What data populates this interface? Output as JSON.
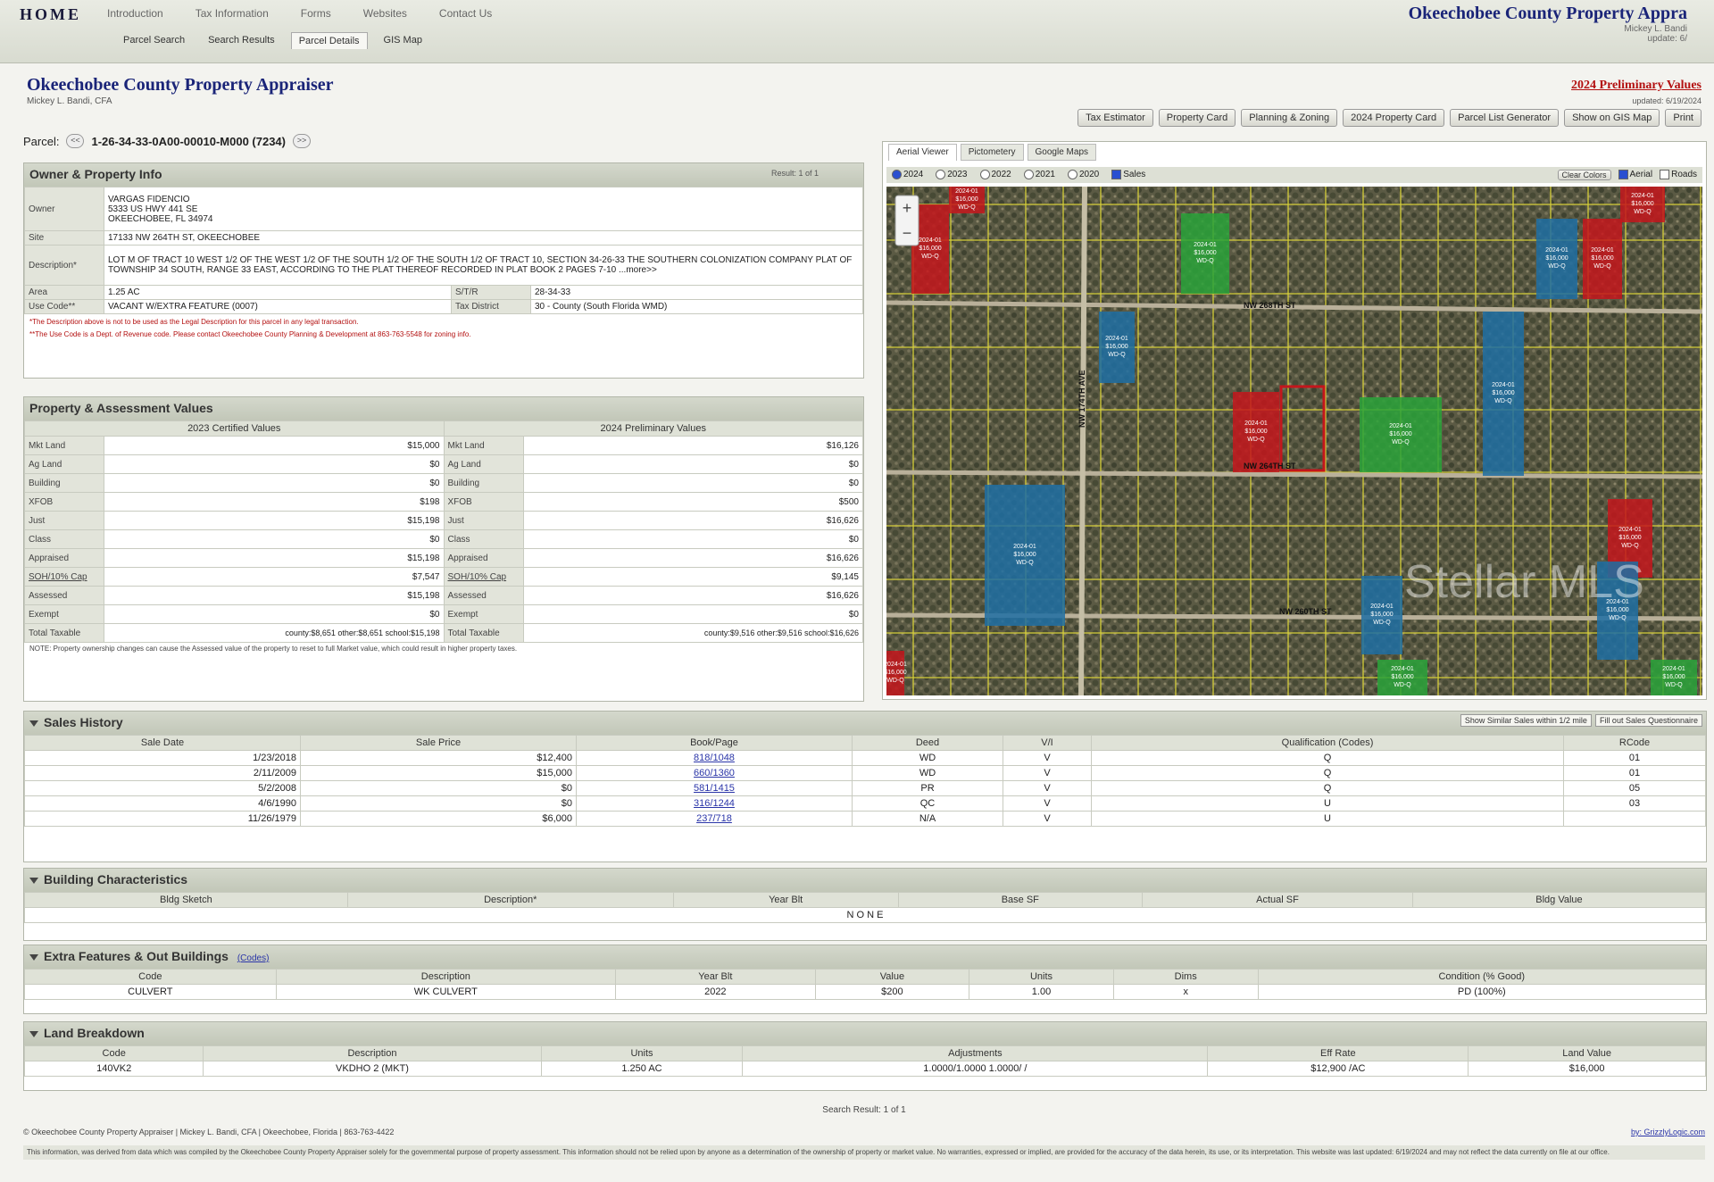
{
  "topnav": {
    "home": "HOME",
    "menu": [
      "Introduction",
      "Tax Information",
      "Forms",
      "Websites",
      "Contact Us"
    ],
    "subtabs": [
      "Parcel Search",
      "Search Results",
      "Parcel Details",
      "GIS Map"
    ],
    "brand_title": "Okeechobee County Property Appra",
    "brand_sub": "Mickey L. Bandi",
    "brand_sub2": "update: 6/"
  },
  "header": {
    "title": "Okeechobee County Property Appraiser",
    "subtitle": "Mickey L. Bandi, CFA",
    "prelim_link": "2024 Preliminary Values",
    "prelim_sub": "updated: 6/19/2024",
    "actions": [
      "Tax Estimator",
      "Property Card",
      "Planning & Zoning",
      "2024 Property Card",
      "Parcel List Generator",
      "Show on GIS Map",
      "Print"
    ],
    "parcel_label": "Parcel:",
    "parcel_id": "1-26-34-33-0A00-00010-M000 (7234)"
  },
  "owner": {
    "title": "Owner & Property Info",
    "result": "Result: 1 of 1",
    "rows": [
      {
        "label": "Owner",
        "value": "VARGAS FIDENCIO\n5333 US HWY 441 SE\nOKEECHOBEE, FL 34974"
      },
      {
        "label": "Site",
        "value": "17133 NW 264TH ST, OKEECHOBEE"
      },
      {
        "label": "Description*",
        "value": "LOT M OF TRACT 10 WEST 1/2 OF THE WEST 1/2 OF THE SOUTH 1/2 OF THE SOUTH 1/2 OF TRACT 10, SECTION 34-26-33 THE SOUTHERN COLONIZATION COMPANY PLAT OF TOWNSHIP 34 SOUTH, RANGE 33 EAST, ACCORDING TO THE PLAT THEREOF RECORDED IN PLAT BOOK 2 PAGES 7-10 ...more>>"
      }
    ],
    "area_label": "Area",
    "area": "1.25 AC",
    "str_label": "S/T/R",
    "str": "28-34-33",
    "usecode_label": "Use Code**",
    "usecode": "VACANT W/EXTRA FEATURE (0007)",
    "taxdist_label": "Tax District",
    "taxdist": "30 - County (South Florida WMD)",
    "note1": "*The Description above is not to be used as the Legal Description for this parcel in any legal transaction.",
    "note2": "**The Use Code is a Dept. of Revenue code. Please contact Okeechobee County Planning & Development at 863-763-5548 for zoning info."
  },
  "assessment": {
    "title": "Property & Assessment Values",
    "col1_title": "2023 Certified Values",
    "col2_title": "2024 Preliminary Values",
    "rows": [
      {
        "label": "Mkt Land",
        "v1": "$15,000",
        "v2": "$16,126"
      },
      {
        "label": "Ag Land",
        "v1": "$0",
        "v2": "$0"
      },
      {
        "label": "Building",
        "v1": "$0",
        "v2": "$0"
      },
      {
        "label": "XFOB",
        "v1": "$198",
        "v2": "$500"
      },
      {
        "label": "Just",
        "v1": "$15,198",
        "v2": "$16,626"
      },
      {
        "label": "Class",
        "v1": "$0",
        "v2": "$0"
      },
      {
        "label": "Appraised",
        "v1": "$15,198",
        "v2": "$16,626"
      },
      {
        "label": "SOH/10% Cap",
        "v1": "$7,547",
        "v2": "$9,145",
        "link": true
      },
      {
        "label": "Assessed",
        "v1": "$15,198",
        "v2": "$16,626"
      },
      {
        "label": "Exempt",
        "v1": "$0",
        "v2": "$0"
      },
      {
        "label": "Total Taxable",
        "v1": "county:$8,651 other:$8,651 school:$15,198",
        "v2": "county:$9,516 other:$9,516 school:$16,626"
      }
    ],
    "note": "NOTE: Property ownership changes can cause the Assessed value of the property to reset to full Market value, which could result in higher property taxes."
  },
  "map": {
    "tabs": [
      "Aerial Viewer",
      "Pictometery",
      "Google Maps"
    ],
    "years": [
      "2024",
      "2023",
      "2022",
      "2021",
      "2020"
    ],
    "sales_label": "Sales",
    "right_btn": "Clear Colors",
    "aerial_label": "Aerial",
    "roads_label": "Roads",
    "watermark": "Stellar MLS",
    "street_labels": [
      "NW 268TH ST",
      "NW 264TH ST",
      "NW 260TH ST",
      "NW 174TH AVE"
    ],
    "parcel_tag": "2024-01\n$16,000\nWD-Q"
  },
  "sales": {
    "title": "Sales History",
    "btn1": "Show Similar Sales within 1/2 mile",
    "btn2": "Fill out Sales Questionnaire",
    "headers": [
      "Sale Date",
      "Sale Price",
      "Book/Page",
      "Deed",
      "V/I",
      "Qualification (Codes)",
      "RCode"
    ],
    "rows": [
      [
        "1/23/2018",
        "$12,400",
        "818/1048",
        "WD",
        "V",
        "Q",
        "01"
      ],
      [
        "2/11/2009",
        "$15,000",
        "660/1360",
        "WD",
        "V",
        "Q",
        "01"
      ],
      [
        "5/2/2008",
        "$0",
        "581/1415",
        "PR",
        "V",
        "Q",
        "05"
      ],
      [
        "4/6/1990",
        "$0",
        "316/1244",
        "QC",
        "V",
        "U",
        "03"
      ],
      [
        "11/26/1979",
        "$6,000",
        "237/718",
        "N/A",
        "V",
        "U",
        ""
      ]
    ]
  },
  "building": {
    "title": "Building Characteristics",
    "headers": [
      "Bldg Sketch",
      "Description*",
      "Year Blt",
      "Base SF",
      "Actual SF",
      "Bldg Value"
    ],
    "none": "N O N E"
  },
  "extra": {
    "title": "Extra Features & Out Buildings",
    "codes_link": "(Codes)",
    "headers": [
      "Code",
      "Description",
      "Year Blt",
      "Value",
      "Units",
      "Dims",
      "Condition (% Good)"
    ],
    "rows": [
      [
        "CULVERT",
        "WK CULVERT",
        "2022",
        "$200",
        "1.00",
        "x",
        "PD (100%)"
      ]
    ]
  },
  "land": {
    "title": "Land Breakdown",
    "headers": [
      "Code",
      "Description",
      "Units",
      "Adjustments",
      "Eff Rate",
      "Land Value"
    ],
    "rows": [
      [
        "140VK2",
        "VKDHO 2 (MKT)",
        "1.250 AC",
        "1.0000/1.0000 1.0000/ /",
        "$12,900 /AC",
        "$16,000"
      ]
    ]
  },
  "footer": {
    "result": "Search Result: 1 of 1",
    "copyright": "© Okeechobee County Property Appraiser | Mickey L. Bandi, CFA | Okeechobee, Florida | 863-763-4422",
    "credit": "by: GrizzlyLogic.com",
    "disclaimer": "This information, was derived from data which was compiled by the Okeechobee County Property Appraiser solely for the governmental purpose of property assessment. This information should not be relied upon by anyone as a determination of the ownership of property or market value. No warranties, expressed or implied, are provided for the accuracy of the data herein, its use, or its interpretation. This website was last updated: 6/19/2024 and may not reflect the data currently on file at our office."
  },
  "colors": {
    "accent": "#1a2478",
    "link_red": "#b31010",
    "panel_header": "#c7cbbd",
    "parcel_red": "#c4161c",
    "parcel_blue": "#1f6fa3",
    "parcel_green": "#2aa33a"
  }
}
